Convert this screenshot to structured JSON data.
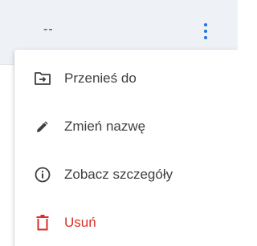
{
  "row": {
    "cell_value": "--",
    "more_icon": "more-vert-icon"
  },
  "menu": {
    "items": [
      {
        "label": "Przenieś do",
        "icon": "move-to-folder-icon"
      },
      {
        "label": "Zmień nazwę",
        "icon": "pencil-icon"
      },
      {
        "label": "Zobacz szczegóły",
        "icon": "info-icon"
      },
      {
        "label": "Usuń",
        "icon": "trash-icon",
        "color": "#d93025"
      }
    ]
  },
  "colors": {
    "accent": "#1a73e8",
    "danger": "#d93025",
    "text": "#3c4043",
    "row_background": "#eef1f6"
  }
}
